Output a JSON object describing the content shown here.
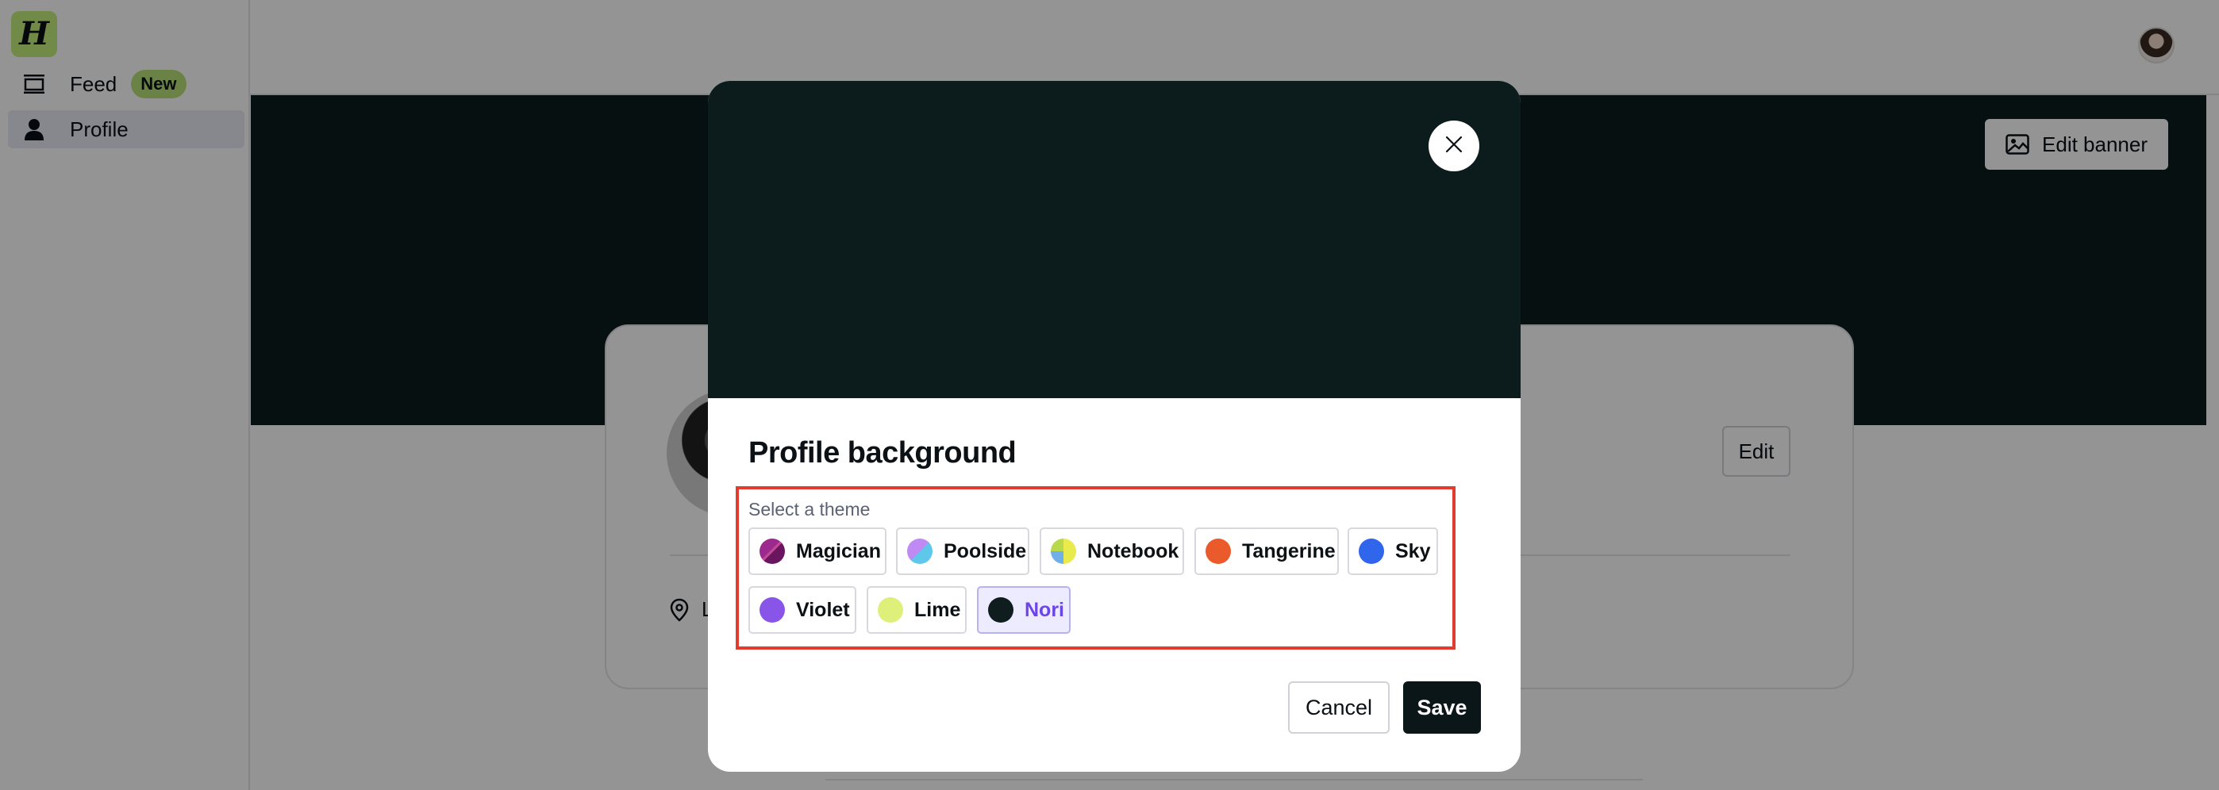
{
  "app": {
    "logo_letter": "H"
  },
  "sidebar": {
    "items": [
      {
        "label": "Feed",
        "icon": "feed-icon",
        "badge": "New"
      },
      {
        "label": "Profile",
        "icon": "person-icon"
      }
    ]
  },
  "banner": {
    "edit_label": "Edit banner",
    "color": "#0c1c1d"
  },
  "profile_card": {
    "edit_label": "Edit",
    "location_text": "L"
  },
  "modal": {
    "title": "Profile background",
    "theme_label": "Select a theme",
    "preview_color": "#0c1c1d",
    "themes": [
      {
        "label": "Magician",
        "swatch": "#7a1a6e"
      },
      {
        "label": "Poolside",
        "swatch": "#a06be8"
      },
      {
        "label": "Notebook",
        "swatch": "#e6e94a"
      },
      {
        "label": "Tangerine",
        "swatch": "#ea5a2a"
      },
      {
        "label": "Sky",
        "swatch": "#2f66ec"
      },
      {
        "label": "Violet",
        "swatch": "#8855e8"
      },
      {
        "label": "Lime",
        "swatch": "#dff07a"
      },
      {
        "label": "Nori",
        "swatch": "#0f1d1e",
        "selected": true
      }
    ],
    "cancel_label": "Cancel",
    "save_label": "Save"
  },
  "colors": {
    "accent": "#6b45e6",
    "highlight": "#e33b2e"
  }
}
